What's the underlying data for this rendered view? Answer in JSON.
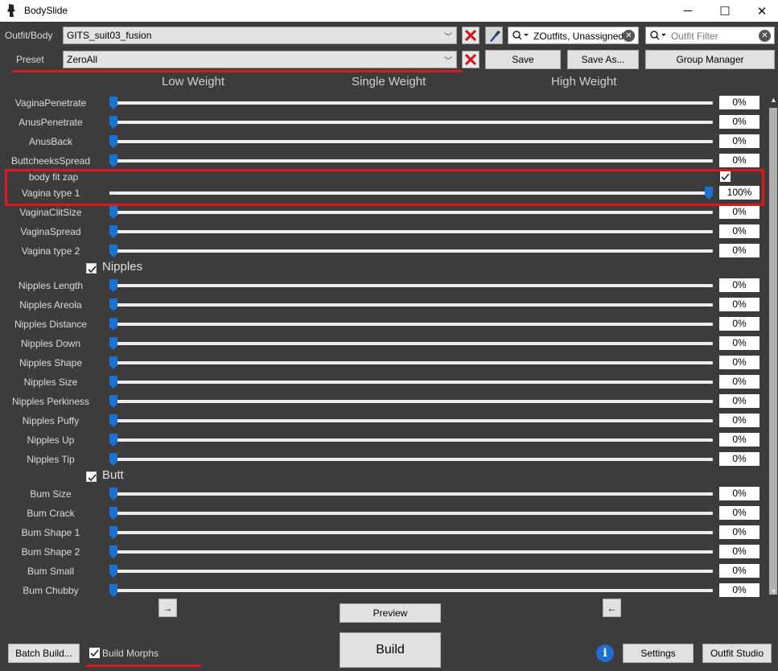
{
  "window": {
    "title": "BodySlide",
    "minimize_icon": "─",
    "maximize_icon": "☐",
    "close_icon": "✕"
  },
  "top": {
    "outfit_label": "Outfit/Body",
    "outfit_value": "GITS_suit03_fusion",
    "preset_label": "Preset",
    "preset_value": "ZeroAll",
    "group_filter_value": "ZOutfits, Unassigned",
    "outfit_filter_placeholder": "Outfit Filter",
    "save_label": "Save",
    "save_as_label": "Save As...",
    "group_manager_label": "Group Manager"
  },
  "columns": {
    "low": "Low Weight",
    "single": "Single Weight",
    "high": "High Weight"
  },
  "sliders_a": [
    {
      "name": "VaginaPenetrate",
      "value": "0%",
      "level": 0
    },
    {
      "name": "AnusPenetrate",
      "value": "0%",
      "level": 0
    },
    {
      "name": "AnusBack",
      "value": "0%",
      "level": 0
    },
    {
      "name": "ButtcheeksSpread",
      "value": "0%",
      "level": 0
    }
  ],
  "zap": {
    "name": "body fit zap",
    "checked": true
  },
  "zap_slider": {
    "name": "Vagina type 1",
    "value": "100%",
    "level": 1
  },
  "sliders_b": [
    {
      "name": "VaginaClitSize",
      "value": "0%",
      "level": 0
    },
    {
      "name": "VaginaSpread",
      "value": "0%",
      "level": 0
    },
    {
      "name": "Vagina type 2",
      "value": "0%",
      "level": 0
    }
  ],
  "sections": {
    "nipples": "Nipples",
    "butt": "Butt"
  },
  "sliders_nipples": [
    {
      "name": "Nipples Length",
      "value": "0%",
      "level": 0
    },
    {
      "name": "Nipples Areola",
      "value": "0%",
      "level": 0
    },
    {
      "name": "Nipples Distance",
      "value": "0%",
      "level": 0
    },
    {
      "name": "Nipples Down",
      "value": "0%",
      "level": 0
    },
    {
      "name": "Nipples Shape",
      "value": "0%",
      "level": 0
    },
    {
      "name": "Nipples Size",
      "value": "0%",
      "level": 0
    },
    {
      "name": "Nipples Perkiness",
      "value": "0%",
      "level": 0
    },
    {
      "name": "Nipples Puffy",
      "value": "0%",
      "level": 0
    },
    {
      "name": "Nipples Up",
      "value": "0%",
      "level": 0
    },
    {
      "name": "Nipples Tip",
      "value": "0%",
      "level": 0
    }
  ],
  "sliders_butt": [
    {
      "name": "Bum Size",
      "value": "0%",
      "level": 0
    },
    {
      "name": "Bum Crack",
      "value": "0%",
      "level": 0
    },
    {
      "name": "Bum Shape 1",
      "value": "0%",
      "level": 0
    },
    {
      "name": "Bum Shape 2",
      "value": "0%",
      "level": 0
    },
    {
      "name": "Bum Small",
      "value": "0%",
      "level": 0
    },
    {
      "name": "Bum Chubby",
      "value": "0%",
      "level": 0
    }
  ],
  "bottom": {
    "left_arrow_btn": "→",
    "right_arrow_btn": "←",
    "preview_label": "Preview",
    "build_label": "Build",
    "batch_build_label": "Batch Build...",
    "build_morphs_label": "Build Morphs",
    "build_morphs_checked": true,
    "info_icon": "i",
    "settings_label": "Settings",
    "outfit_studio_label": "Outfit Studio"
  },
  "colors": {
    "accent_blue": "#1a72d1",
    "highlight_red": "#e0161f",
    "background": "#3c3c3c"
  }
}
